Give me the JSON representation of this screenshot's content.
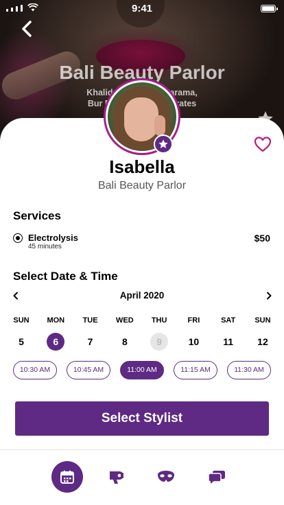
{
  "status_bar": {
    "time": "9:41"
  },
  "hero": {
    "salon_title": "Bali Beauty Parlor",
    "address_line1": "Khalid Bin          Al Karama,",
    "address_line2": "Bur Dubai          b Emirates"
  },
  "profile": {
    "name": "Isabella",
    "salon": "Bali Beauty Parlor"
  },
  "services": {
    "title": "Services",
    "items": [
      {
        "name": "Electrolysis",
        "duration": "45 minutes",
        "price": "$50",
        "selected": true
      }
    ]
  },
  "datetime": {
    "title": "Select Date & Time",
    "month": "April 2020",
    "days": [
      {
        "weekday": "SUN",
        "date": "5"
      },
      {
        "weekday": "MON",
        "date": "6",
        "state": "selected"
      },
      {
        "weekday": "TUE",
        "date": "7"
      },
      {
        "weekday": "WED",
        "date": "8"
      },
      {
        "weekday": "THU",
        "date": "9",
        "state": "disabled"
      },
      {
        "weekday": "FRI",
        "date": "10"
      },
      {
        "weekday": "SAT",
        "date": "11"
      },
      {
        "weekday": "SUN",
        "date": "12"
      }
    ],
    "times": [
      {
        "label": "10:30 AM"
      },
      {
        "label": "10:45 AM"
      },
      {
        "label": "11:00 AM",
        "selected": true
      },
      {
        "label": "11:15 AM"
      },
      {
        "label": "11:30 AM"
      }
    ]
  },
  "cta": {
    "label": "Select Stylist"
  },
  "bottom_nav": {
    "items": [
      {
        "icon": "calendar-icon",
        "active": true
      },
      {
        "icon": "hair-dryer-icon"
      },
      {
        "icon": "eye-mask-icon"
      },
      {
        "icon": "chat-icon"
      }
    ]
  },
  "colors": {
    "accent": "#5e2a84",
    "avatar_ring": "#a1208a",
    "favorite": "#c2187a"
  }
}
